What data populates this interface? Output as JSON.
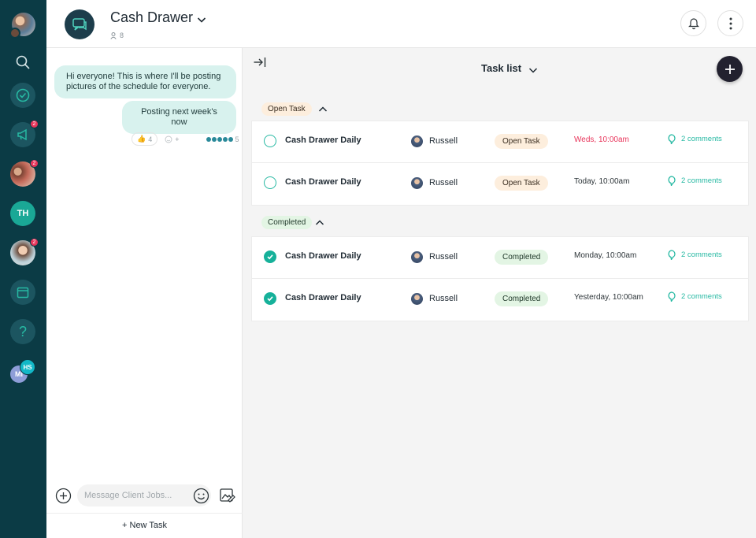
{
  "rail": {
    "user_initials_bottom": "HS",
    "user_initials_back": "MI",
    "th_initials": "TH",
    "badges": [
      "2",
      "2",
      "2"
    ],
    "help_glyph": "?"
  },
  "header": {
    "channel_title": "Cash Drawer",
    "member_count": "8"
  },
  "chat": {
    "messages": [
      {
        "text": "Hi everyone! This is where I'll be posting pictures of the schedule for everyone."
      },
      {
        "text": "Posting next week's now"
      }
    ],
    "reactions": {
      "thumbs_count": "4",
      "add_label": "+",
      "seen_count": "5"
    },
    "composer_placeholder": "Message Client Jobs...",
    "new_task_label": "+ New Task"
  },
  "panel": {
    "title": "Task list",
    "sections": [
      {
        "label": "Open Task",
        "tasks": [
          {
            "name": "Cash Drawer Daily",
            "assignee": "Russell",
            "status": "Open Task",
            "due": "Weds, 10:00am",
            "comments": "2 comments"
          },
          {
            "name": "Cash Drawer Daily",
            "assignee": "Russell",
            "status": "Open Task",
            "due": "Today, 10:00am",
            "comments": "2 comments"
          }
        ]
      },
      {
        "label": "Completed",
        "tasks": [
          {
            "name": "Cash Drawer Daily",
            "assignee": "Russell",
            "status": "Completed",
            "due": "Monday, 10:00am",
            "comments": "2 comments"
          },
          {
            "name": "Cash Drawer Daily",
            "assignee": "Russell",
            "status": "Completed",
            "due": "Yesterday, 10:00am",
            "comments": "2 comments"
          }
        ]
      }
    ]
  },
  "colors": {
    "rail_bg": "#0b3b45",
    "accent_teal": "#27b9a3",
    "late_due": "#e8345a",
    "add_button": "#22212f"
  }
}
